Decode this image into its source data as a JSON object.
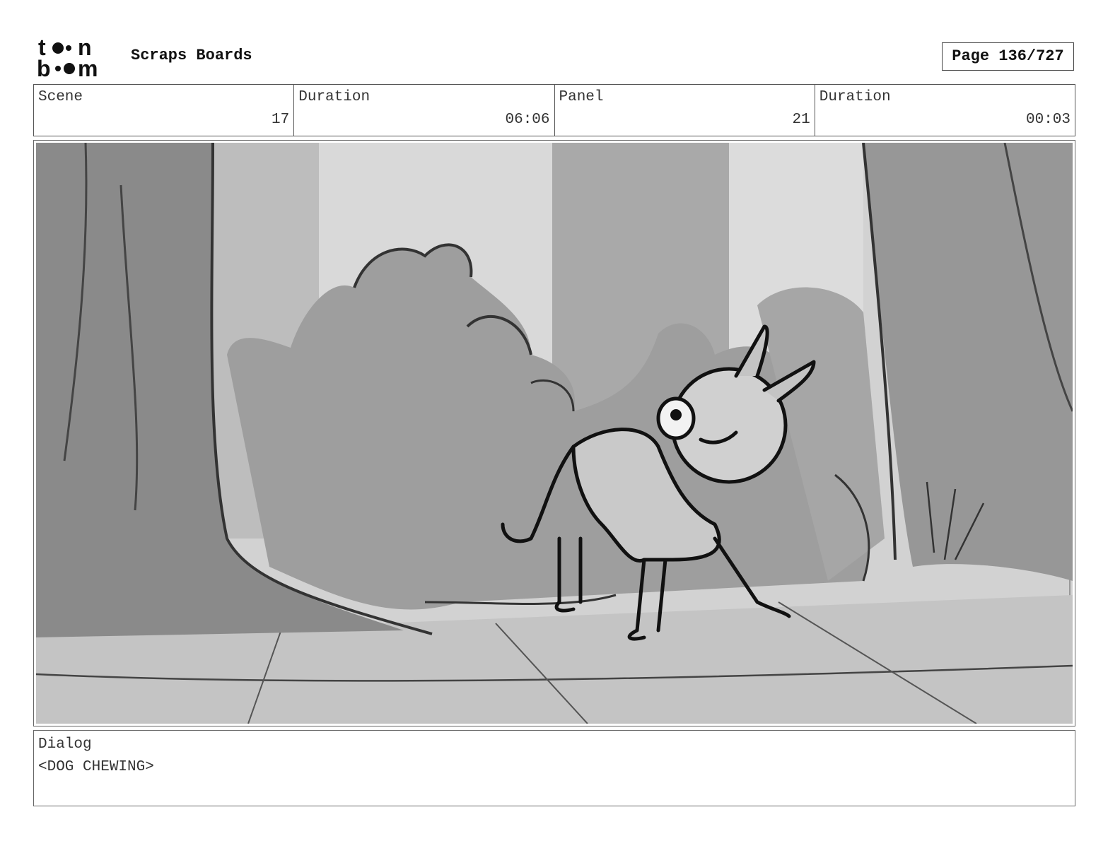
{
  "header": {
    "logo_text": "toon boom",
    "board_title": "Scraps Boards",
    "page_label": "Page 136/727"
  },
  "info": {
    "scene_label": "Scene",
    "scene_value": "17",
    "duration_label": "Duration",
    "duration_value": "06:06",
    "panel_label": "Panel",
    "panel_value": "21",
    "panel_duration_label": "Duration",
    "panel_duration_value": "00:03"
  },
  "panel_image": {
    "description_icon": "storyboard-sketch-dog-in-forest"
  },
  "dialog": {
    "label": "Dialog",
    "text": "<DOG CHEWING>"
  }
}
